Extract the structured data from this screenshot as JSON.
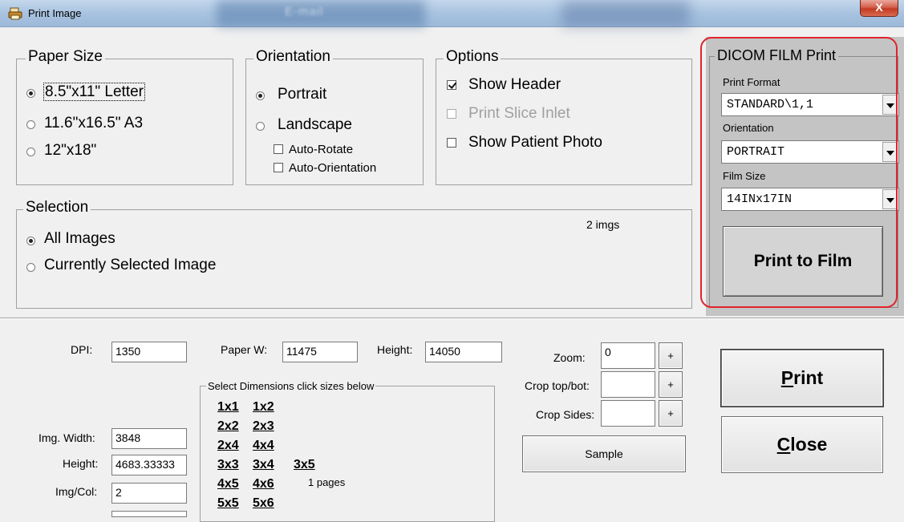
{
  "window": {
    "title": "Print Image",
    "close_label": "X",
    "background_text": "E-mail"
  },
  "paper_size": {
    "legend": "Paper Size",
    "options": [
      {
        "label": "8.5\"x11\" Letter",
        "selected": true
      },
      {
        "label": "11.6\"x16.5\" A3",
        "selected": false
      },
      {
        "label": "12\"x18\"",
        "selected": false
      }
    ]
  },
  "orientation": {
    "legend": "Orientation",
    "options": [
      {
        "label": "Portrait",
        "selected": true
      },
      {
        "label": "Landscape",
        "selected": false
      }
    ],
    "checkboxes": [
      {
        "label": "Auto-Rotate",
        "checked": false
      },
      {
        "label": "Auto-Orientation",
        "checked": false
      }
    ]
  },
  "options": {
    "legend": "Options",
    "checkboxes": [
      {
        "label": "Show Header",
        "checked": true,
        "enabled": true
      },
      {
        "label": "Print Slice Inlet",
        "checked": false,
        "enabled": false
      },
      {
        "label": "Show Patient Photo",
        "checked": false,
        "enabled": true
      }
    ]
  },
  "selection": {
    "legend": "Selection",
    "count": "2 imgs",
    "options": [
      {
        "label": "All Images",
        "selected": true
      },
      {
        "label": "Currently Selected Image",
        "selected": false
      }
    ]
  },
  "dicom": {
    "legend": "DICOM FILM Print",
    "print_format": {
      "label": "Print Format",
      "value": "STANDARD\\1,1"
    },
    "orientation": {
      "label": "Orientation",
      "value": "PORTRAIT"
    },
    "film_size": {
      "label": "Film Size",
      "value": "14INx17IN"
    },
    "print_to_film_label": "Print to Film",
    "highlight_color": "#e0232b"
  },
  "fields": {
    "dpi": {
      "label": "DPI:",
      "value": "1350"
    },
    "paper_w": {
      "label": "Paper W:",
      "value": "11475"
    },
    "height": {
      "label": "Height:",
      "value": "14050"
    },
    "img_width": {
      "label": "Img. Width:",
      "value": "3848"
    },
    "img_height": {
      "label": "Height:",
      "value": "4683.33333"
    },
    "img_col": {
      "label": "Img/Col:",
      "value": "2"
    }
  },
  "dimensions": {
    "legend": "Select Dimensions click sizes below",
    "rows": [
      [
        "1x1",
        "1x2"
      ],
      [
        "2x2",
        "2x3"
      ],
      [
        "2x4",
        "4x4"
      ],
      [
        "3x3",
        "3x4",
        "3x5"
      ],
      [
        "4x5",
        "4x6"
      ],
      [
        "5x5",
        "5x6"
      ]
    ],
    "pages": "1 pages"
  },
  "zoom": {
    "zoom_label": "Zoom:",
    "zoom_value": "0",
    "crop_tb_label": "Crop top/bot:",
    "crop_tb_value": "",
    "crop_sides_label": "Crop Sides:",
    "crop_sides_value": "",
    "plus_label": "+",
    "sample_label": "Sample"
  },
  "actions": {
    "print": {
      "hotkey": "P",
      "rest": "rint"
    },
    "close": {
      "hotkey": "C",
      "rest": "lose"
    }
  }
}
